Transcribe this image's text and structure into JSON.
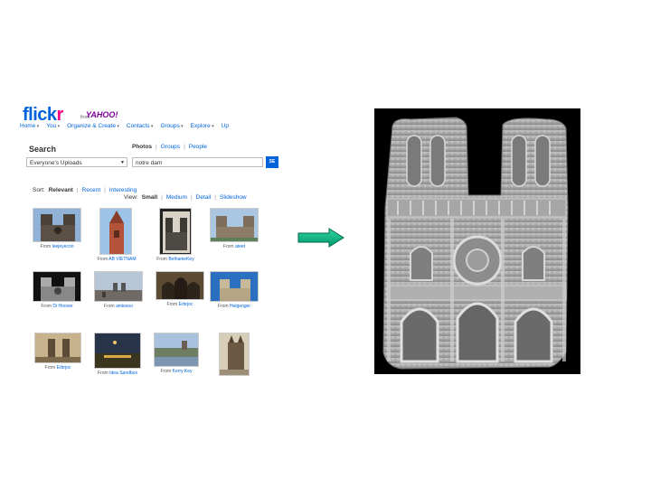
{
  "flickr": {
    "logo": {
      "brand_main": "flick",
      "brand_accent": "r",
      "from": "from",
      "yahoo": "YAHOO!"
    },
    "nav": [
      "Home",
      "You",
      "Organize & Create",
      "Contacts",
      "Groups",
      "Explore",
      "Up"
    ],
    "search": {
      "label": "Search",
      "tabs": [
        "Photos",
        "Groups",
        "People"
      ],
      "scope_value": "Everyone's Uploads",
      "query_value": "notre dam",
      "button_label": "SE"
    },
    "sort": {
      "label": "Sort:",
      "options": [
        "Relevant",
        "Recent",
        "Interesting"
      ]
    },
    "view": {
      "label": "View:",
      "options": [
        "Small",
        "Medium",
        "Detail",
        "Slideshow"
      ]
    },
    "results": [
      {
        "caption_prefix": "From",
        "user": "leejeyecon"
      },
      {
        "caption_prefix": "From",
        "user": "AB VIETNAM"
      },
      {
        "caption_prefix": "From",
        "user": "BethanieKey"
      },
      {
        "caption_prefix": "From",
        "user": "ateet"
      },
      {
        "caption_prefix": "From",
        "user": "Di Hoover"
      },
      {
        "caption_prefix": "From",
        "user": "amiesoo"
      },
      {
        "caption_prefix": "From",
        "user": "Erbrjoc"
      },
      {
        "caption_prefix": "From",
        "user": "Helgenger"
      },
      {
        "caption_prefix": "From",
        "user": "Erbrjoc"
      },
      {
        "caption_prefix": "From",
        "user": "Idea Sandbox"
      },
      {
        "caption_prefix": "From",
        "user": "Kerry Key"
      },
      {
        "caption_prefix": "",
        "user": ""
      }
    ]
  },
  "colors": {
    "flickr_blue": "#0063dc",
    "flickr_pink": "#ff0084",
    "arrow_fill": "#00a878",
    "model_bg": "#000000",
    "model_surface": "#a9a9a9"
  },
  "icons": {
    "arrow": "right-arrow-icon",
    "model": "notre-dame-3d-model"
  }
}
